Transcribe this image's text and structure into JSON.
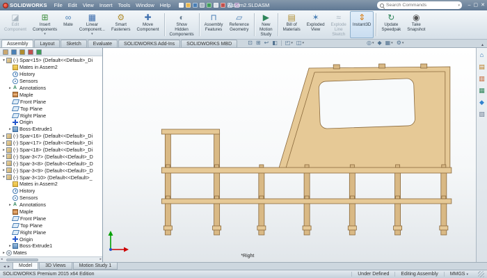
{
  "window": {
    "brand": "SOLIDWORKS",
    "title": "Assem2.SLDASM",
    "search_placeholder": "Search Commands"
  },
  "colors": {
    "wood_light": "#e6c996",
    "wood_mid": "#d9b985",
    "wood_dark": "#8a693c",
    "window_fill": "#f8fafb",
    "accent_blue": "#4a7fb5"
  },
  "menus": [
    "File",
    "Edit",
    "View",
    "Insert",
    "Tools",
    "Window",
    "Help"
  ],
  "titlebar_icons": [
    {
      "name": "new-document",
      "color": "#f4f7fa"
    },
    {
      "name": "open",
      "color": "#e8b64c"
    },
    {
      "name": "save",
      "color": "#4a7fb5"
    },
    {
      "name": "print",
      "color": "#aab6c2"
    },
    {
      "name": "undo",
      "color": "#3f9d5a"
    },
    {
      "name": "select",
      "color": "#d8dee5"
    },
    {
      "name": "rebuild",
      "color": "#c0504d"
    },
    {
      "name": "file-properties",
      "color": "#8fa6c0"
    },
    {
      "name": "options",
      "color": "#9a7fb5"
    }
  ],
  "window_controls": [
    "minimize",
    "maximize",
    "close"
  ],
  "ribbon": [
    {
      "name": "edit-component",
      "lines": [
        "Edit",
        "Component"
      ],
      "glyph": "◪",
      "color": "#8a99a6",
      "state": "disabled"
    },
    {
      "name": "insert-components",
      "lines": [
        "Insert",
        "Components"
      ],
      "glyph": "⊞",
      "color": "#3f8f3f",
      "dropdown": true
    },
    {
      "name": "mate",
      "lines": [
        "Mate"
      ],
      "glyph": "∞",
      "color": "#4a7fb5"
    },
    {
      "name": "linear-component-pattern",
      "lines": [
        "Linear",
        "Component..."
      ],
      "glyph": "▦",
      "color": "#3f6fae",
      "dropdown": true
    },
    {
      "name": "smart-fasteners",
      "lines": [
        "Smart",
        "Fasteners"
      ],
      "glyph": "⚙",
      "color": "#b08d2f"
    },
    {
      "name": "move-component",
      "lines": [
        "Move",
        "Component"
      ],
      "glyph": "✚",
      "color": "#3f6fae"
    },
    {
      "separator": true
    },
    {
      "name": "show-hidden-components",
      "lines": [
        "Show",
        "Hidden",
        "Components"
      ],
      "glyph": "◐",
      "color": "#6a7f93"
    },
    {
      "separator": true
    },
    {
      "name": "assembly-features",
      "lines": [
        "Assembly",
        "Features"
      ],
      "glyph": "⊓",
      "color": "#4a7fb5"
    },
    {
      "name": "reference-geometry",
      "lines": [
        "Reference",
        "Geometry"
      ],
      "glyph": "▱",
      "color": "#4a7fb5"
    },
    {
      "separator": true
    },
    {
      "name": "new-motion-study",
      "lines": [
        "New",
        "Motion",
        "Study"
      ],
      "glyph": "▶",
      "color": "#2f855a"
    },
    {
      "separator": true
    },
    {
      "name": "bill-of-materials",
      "lines": [
        "Bill of",
        "Materials"
      ],
      "glyph": "▤",
      "color": "#b08d2f"
    },
    {
      "name": "exploded-view",
      "lines": [
        "Exploded",
        "View"
      ],
      "glyph": "✶",
      "color": "#4a7fb5"
    },
    {
      "name": "explode-line-sketch",
      "lines": [
        "Explode",
        "Line",
        "Sketch"
      ],
      "glyph": "≈",
      "color": "#8a99a6",
      "state": "disabled"
    },
    {
      "name": "instant3d",
      "lines": [
        "Instant3D"
      ],
      "glyph": "⇕",
      "color": "#d97706",
      "state": "active"
    },
    {
      "separator": true
    },
    {
      "name": "update-speedpak",
      "lines": [
        "Update",
        "Speedpak"
      ],
      "glyph": "↻",
      "color": "#2f855a"
    },
    {
      "name": "take-snapshot",
      "lines": [
        "Take",
        "Snapshot"
      ],
      "glyph": "◉",
      "color": "#555555"
    }
  ],
  "tabs": [
    {
      "label": "Assembly",
      "active": true
    },
    {
      "label": "Layout"
    },
    {
      "label": "Sketch"
    },
    {
      "label": "Evaluate"
    },
    {
      "label": "SOLIDWORKS Add-Ins"
    },
    {
      "label": "SOLIDWORKS MBD"
    }
  ],
  "view_toolbar": [
    {
      "name": "zoom-fit",
      "glyph": "⊡"
    },
    {
      "name": "zoom-area",
      "glyph": "⊞"
    },
    {
      "name": "previous-view",
      "glyph": "↩"
    },
    {
      "name": "section-view",
      "glyph": "◧"
    },
    {
      "divider": true
    },
    {
      "name": "view-orientation",
      "glyph": "◰",
      "dropdown": true
    },
    {
      "name": "display-style",
      "glyph": "◫",
      "dropdown": true
    },
    {
      "spacer": true
    },
    {
      "name": "hide-show-items",
      "glyph": "◎",
      "dropdown": true
    },
    {
      "name": "edit-appearance",
      "glyph": "◆"
    },
    {
      "name": "apply-scene",
      "glyph": "▦",
      "dropdown": true
    },
    {
      "name": "view-settings",
      "glyph": "⚙",
      "dropdown": true
    }
  ],
  "feature_tree": {
    "tabs": [
      {
        "name": "featuremanager-tree",
        "color": "#caa76f"
      },
      {
        "name": "propertymanager",
        "color": "#4a7fb5"
      },
      {
        "name": "configurationmanager",
        "color": "#b08d2f"
      },
      {
        "name": "dimxpertmanager",
        "color": "#c0504d"
      },
      {
        "name": "displaymanager",
        "color": "#3f9d5a"
      }
    ],
    "items": [
      {
        "indent": 0,
        "arrow": "down",
        "icon": "part",
        "label": "(-) Spar<15> (Default<<Default>_Di"
      },
      {
        "indent": 1,
        "icon": "mates-folder",
        "label": "Mates in Assem2"
      },
      {
        "indent": 1,
        "icon": "history",
        "label": "History"
      },
      {
        "indent": 1,
        "icon": "sensors",
        "label": "Sensors"
      },
      {
        "indent": 1,
        "arrow": "right",
        "icon": "annotations",
        "label": "Annotations"
      },
      {
        "indent": 1,
        "icon": "material",
        "label": "Maple"
      },
      {
        "indent": 1,
        "icon": "plane",
        "label": "Front Plane"
      },
      {
        "indent": 1,
        "icon": "plane",
        "label": "Top Plane"
      },
      {
        "indent": 1,
        "icon": "plane",
        "label": "Right Plane"
      },
      {
        "indent": 1,
        "icon": "origin",
        "label": "Origin"
      },
      {
        "indent": 1,
        "arrow": "right",
        "icon": "extrude",
        "label": "Boss-Extrude1"
      },
      {
        "indent": 0,
        "arrow": "right",
        "icon": "part",
        "label": "(-) Spar<16> (Default<<Default>_Di"
      },
      {
        "indent": 0,
        "arrow": "right",
        "icon": "part",
        "label": "(-) Spar<17> (Default<<Default>_Di"
      },
      {
        "indent": 0,
        "arrow": "right",
        "icon": "part",
        "label": "(-) Spar<18> (Default<<Default>_Di"
      },
      {
        "indent": 0,
        "arrow": "right",
        "icon": "part",
        "label": "(-) Spar-3<7> (Default<<Default>_D"
      },
      {
        "indent": 0,
        "arrow": "right",
        "icon": "part",
        "label": "(-) Spar-3<8> (Default<<Default>_D"
      },
      {
        "indent": 0,
        "arrow": "right",
        "icon": "part",
        "label": "(-) Spar-3<9> (Default<<Default>_D"
      },
      {
        "indent": 0,
        "arrow": "down",
        "icon": "part",
        "label": "(-) Spar-3<10> (Default<<Default>_"
      },
      {
        "indent": 1,
        "icon": "mates-folder",
        "label": "Mates in Assem2"
      },
      {
        "indent": 1,
        "icon": "history",
        "label": "History"
      },
      {
        "indent": 1,
        "icon": "sensors",
        "label": "Sensors"
      },
      {
        "indent": 1,
        "arrow": "right",
        "icon": "annotations",
        "label": "Annotations"
      },
      {
        "indent": 1,
        "icon": "material",
        "label": "Maple"
      },
      {
        "indent": 1,
        "icon": "plane",
        "label": "Front Plane"
      },
      {
        "indent": 1,
        "icon": "plane",
        "label": "Top Plane"
      },
      {
        "indent": 1,
        "icon": "plane",
        "label": "Right Plane"
      },
      {
        "indent": 1,
        "icon": "origin",
        "label": "Origin"
      },
      {
        "indent": 1,
        "arrow": "right",
        "icon": "extrude",
        "label": "Boss-Extrude1"
      },
      {
        "indent": 0,
        "arrow": "right",
        "icon": "mates",
        "label": "Mates"
      }
    ]
  },
  "task_pane": [
    {
      "name": "solidworks-resources",
      "glyph": "⌂",
      "color": "#2b6cb0"
    },
    {
      "name": "design-library",
      "glyph": "▤",
      "color": "#b7791f"
    },
    {
      "name": "file-explorer",
      "glyph": "▥",
      "color": "#c05621"
    },
    {
      "name": "view-palette",
      "glyph": "▦",
      "color": "#2f855a"
    },
    {
      "name": "appearances-scenes",
      "glyph": "◆",
      "color": "#3182ce"
    },
    {
      "name": "custom-properties",
      "glyph": "▧",
      "color": "#718096"
    }
  ],
  "viewport": {
    "annotation": "*Right"
  },
  "doc_tabs": [
    {
      "label": "Model",
      "active": true
    },
    {
      "label": "3D Views"
    },
    {
      "label": "Motion Study 1"
    }
  ],
  "status": {
    "edition": "SOLIDWORKS Premium 2015 x64 Edition",
    "items": [
      {
        "label": "Under Defined"
      },
      {
        "label": "Editing Assembly"
      },
      {
        "label": "MMGS",
        "dropdown": true
      }
    ]
  }
}
